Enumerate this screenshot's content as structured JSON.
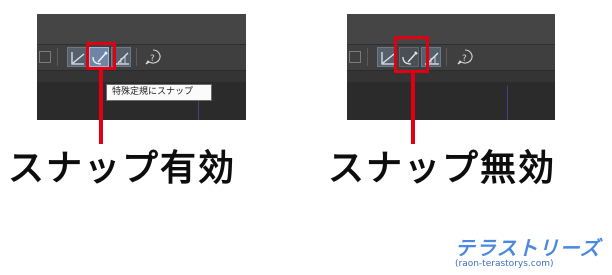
{
  "tooltip": {
    "text": "特殊定規にスナップ"
  },
  "captions": {
    "enabled": "スナップ有効",
    "disabled": "スナップ無効"
  },
  "logo": {
    "word": "テラストリーズ",
    "url": "(raon-terastorys.com)"
  },
  "colors": {
    "highlight_red": "#e00012",
    "toolbar_bg": "#3c3c3c",
    "button_active": "#6e86a6",
    "logo_blue": "#4b88e0"
  },
  "screenshots": [
    {
      "state": "snap-enabled",
      "active_button": "snap-special-ruler"
    },
    {
      "state": "snap-disabled",
      "active_button": "none"
    }
  ],
  "icons": [
    "ruler-snap-icon",
    "special-ruler-snap-icon",
    "grid-snap-icon",
    "help-icon",
    "checkbox-icon"
  ]
}
